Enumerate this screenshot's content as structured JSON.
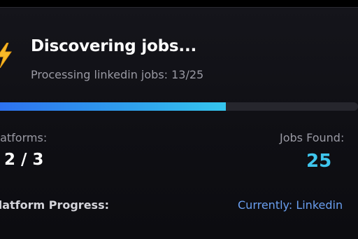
{
  "header": {
    "icon": "lightning-bolt-icon",
    "title": "Discovering jobs...",
    "status": "Processing linkedin jobs: 13/25"
  },
  "progress": {
    "fraction": 0.64,
    "color_start": "#2d6ff0",
    "color_end": "#35c6ee"
  },
  "stats": {
    "platforms_label": "Platforms:",
    "platforms_value": "2 / 3",
    "jobs_found_label": "Jobs Found:",
    "jobs_found_value": "25"
  },
  "platform_progress": {
    "label": "Platform Progress:",
    "current": "Currently: Linkedin"
  },
  "colors": {
    "background": "#0f0f14",
    "accent": "#3fc6ee",
    "link": "#6a9ff0",
    "muted_text": "#9a9aa4"
  }
}
